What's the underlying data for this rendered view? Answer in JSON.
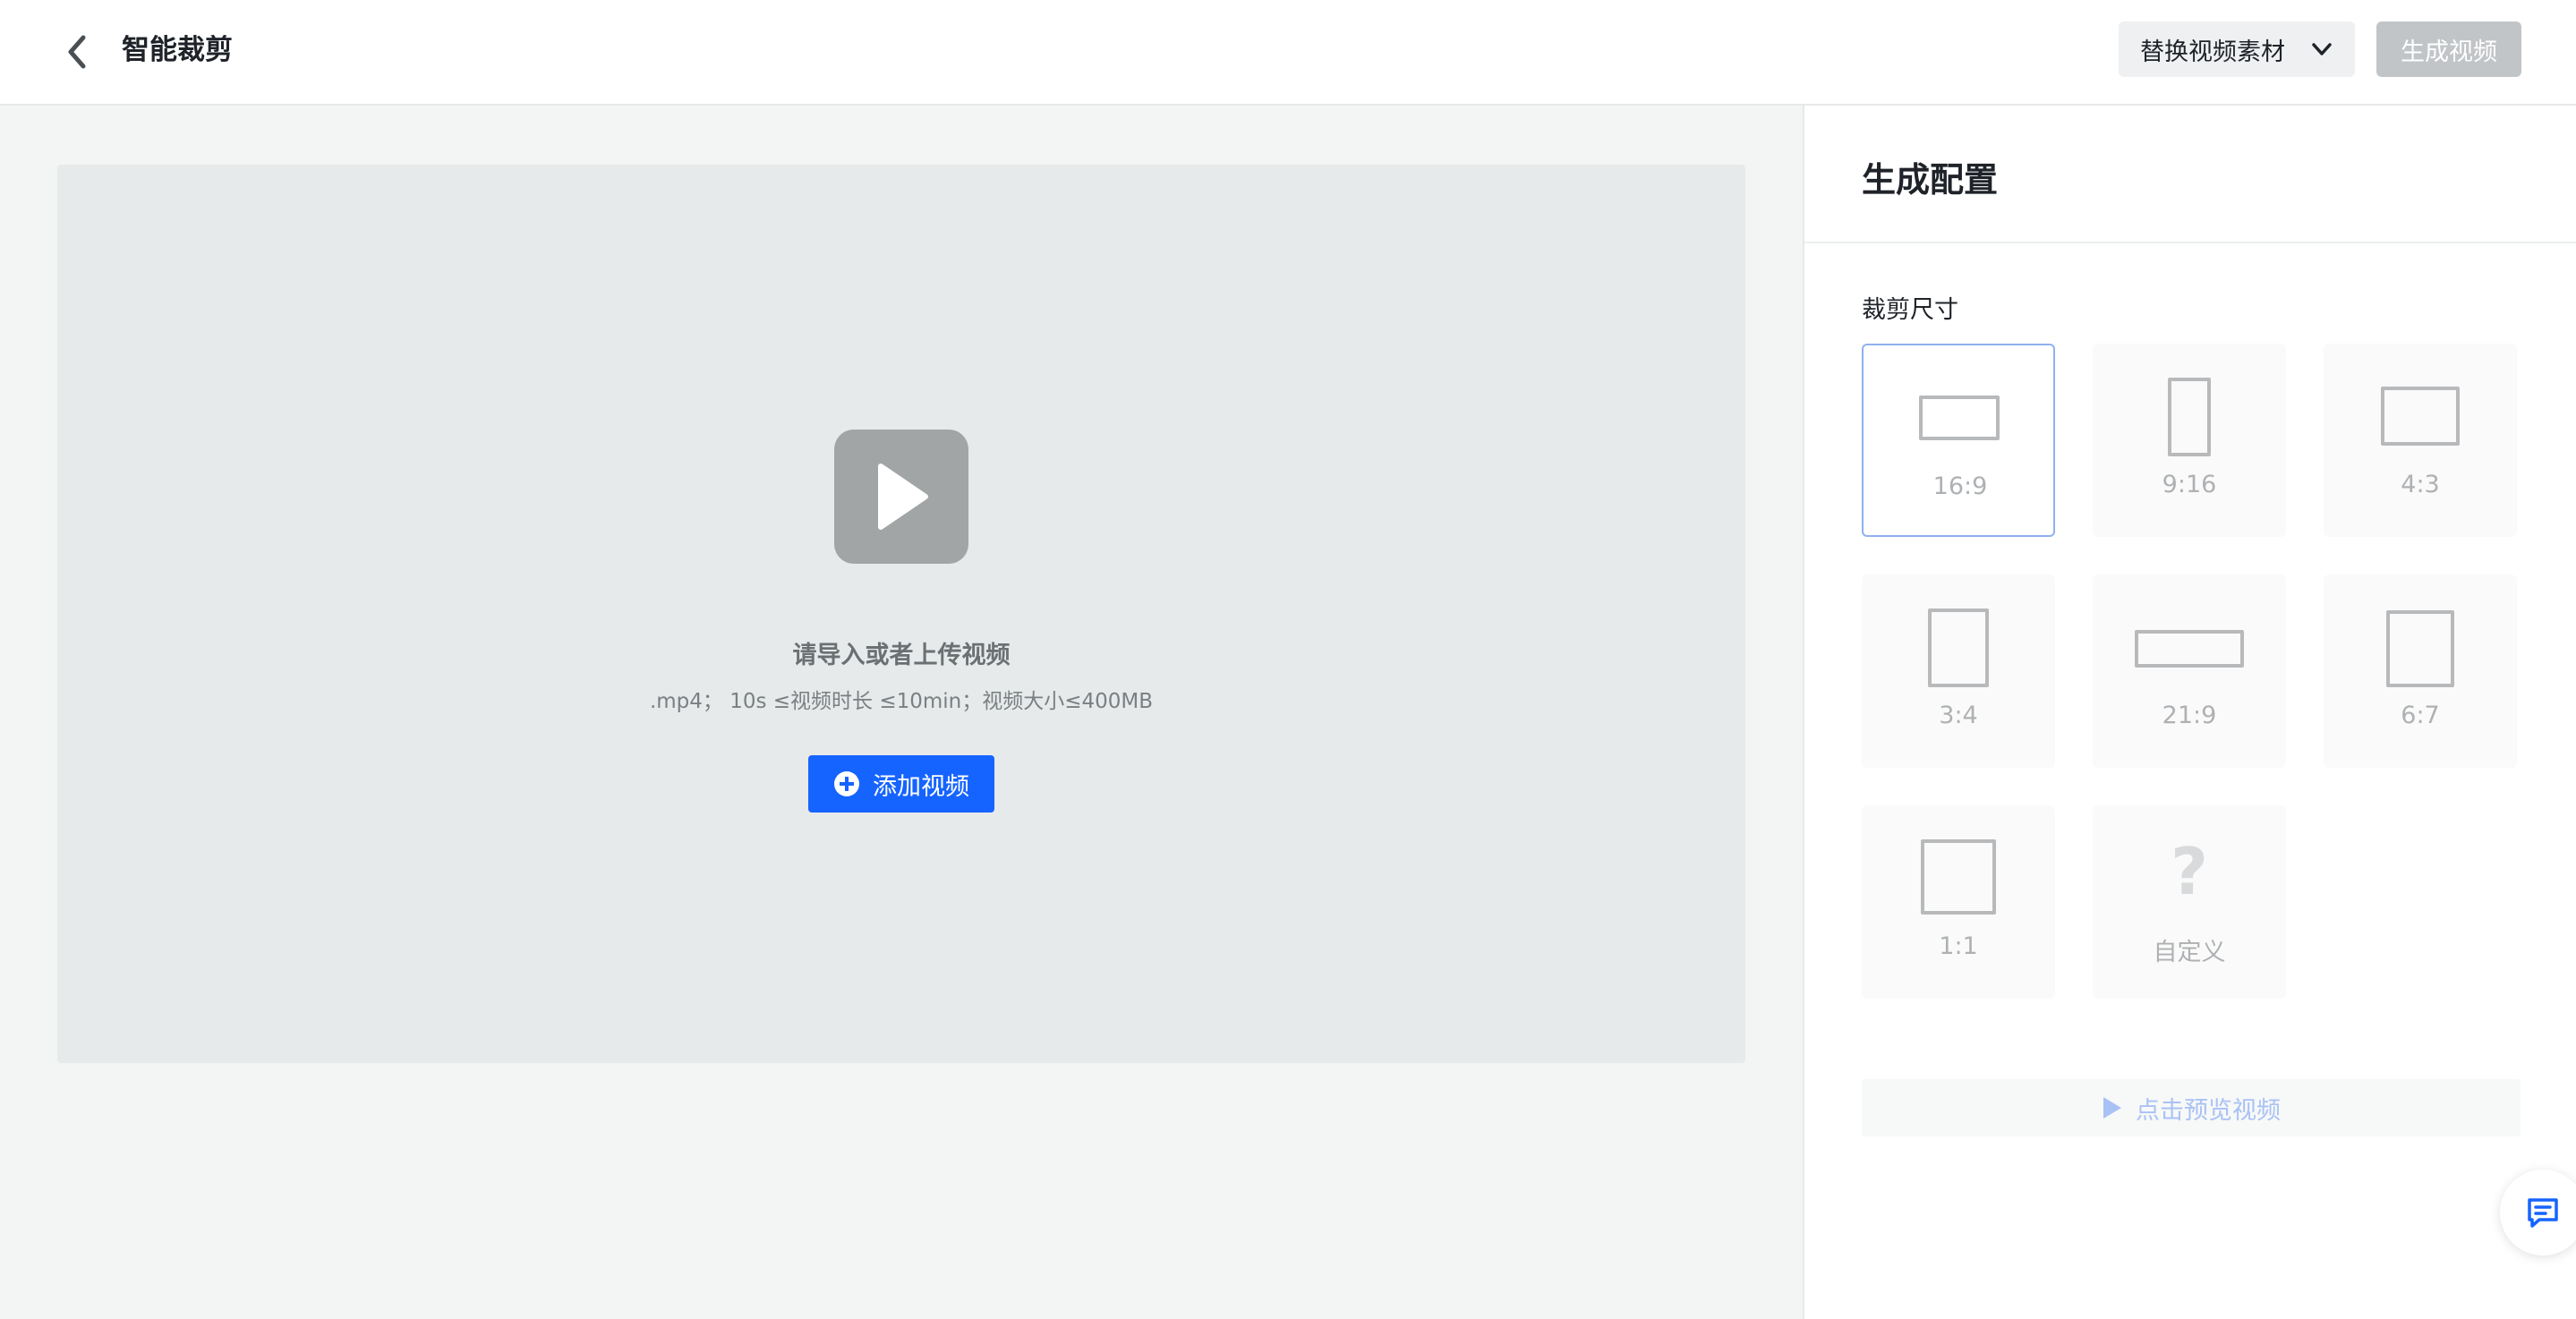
{
  "header": {
    "title": "智能裁剪",
    "replace_label": "替换视频素材",
    "generate_label": "生成视频"
  },
  "preview": {
    "title": "请导入或者上传视频",
    "hint": ".mp4； 10s ≤视频时长 ≤10min；视频大小≤400MB",
    "add_label": "添加视频"
  },
  "panel": {
    "title": "生成配置",
    "section_label": "裁剪尺寸",
    "ratios": [
      {
        "label": "16:9",
        "selected": true
      },
      {
        "label": "9:16",
        "selected": false
      },
      {
        "label": "4:3",
        "selected": false
      },
      {
        "label": "3:4",
        "selected": false
      },
      {
        "label": "21:9",
        "selected": false
      },
      {
        "label": "6:7",
        "selected": false
      },
      {
        "label": "1:1",
        "selected": false
      },
      {
        "label": "自定义",
        "selected": false
      }
    ],
    "preview_label": "点击预览视频"
  },
  "colors": {
    "accent": "#1664ff",
    "selected_border": "#8fb1f0",
    "disabled_button": "#c2c5c8"
  },
  "icons": [
    "chevron-left-icon",
    "chevron-down-icon",
    "play-icon",
    "plus-circle-icon",
    "question-icon",
    "play-triangle-icon",
    "feedback-icon"
  ]
}
